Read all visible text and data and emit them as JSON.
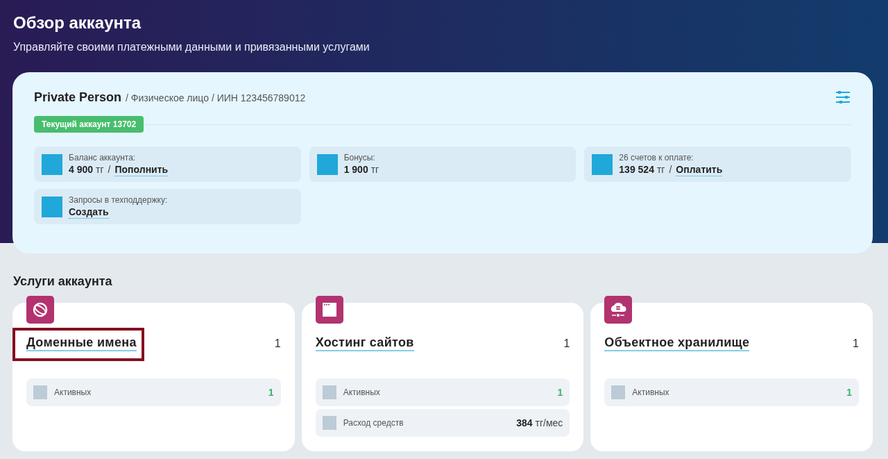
{
  "page": {
    "title": "Обзор аккаунта",
    "subtitle": "Управляйте своими платежными данными и привязанными услугами"
  },
  "account": {
    "name": "Private Person",
    "details": "/ Физическое лицо / ИИН 123456789012",
    "current_badge": "Текущий аккаунт 13702",
    "tiles": [
      {
        "label": "Баланс аккаунта:",
        "value": "4 900",
        "unit": "тг",
        "separator": "/",
        "action": "Пополнить"
      },
      {
        "label": "Бонусы:",
        "value": "1 900",
        "unit": "тг"
      },
      {
        "label": "26 счетов к оплате:",
        "value": "139 524",
        "unit": "тг",
        "separator": "/",
        "action": "Оплатить"
      },
      {
        "label": "Запросы в техподдержку:",
        "action": "Создать"
      }
    ]
  },
  "services_heading": "Услуги аккаунта",
  "services": [
    {
      "kind": "domains",
      "title": "Доменные имена",
      "count": "1",
      "highlighted": true,
      "stats": [
        {
          "kind": "count",
          "label": "Активных",
          "value": "1"
        }
      ]
    },
    {
      "kind": "hosting",
      "title": "Хостинг сайтов",
      "count": "1",
      "highlighted": false,
      "stats": [
        {
          "kind": "count",
          "label": "Активных",
          "value": "1"
        },
        {
          "kind": "amount",
          "label": "Расход средств",
          "value": "384",
          "unit": "тг/мес"
        }
      ]
    },
    {
      "kind": "storage",
      "title": "Объектное хранилище",
      "count": "1",
      "highlighted": false,
      "stats": [
        {
          "kind": "count",
          "label": "Активных",
          "value": "1"
        }
      ]
    }
  ]
}
